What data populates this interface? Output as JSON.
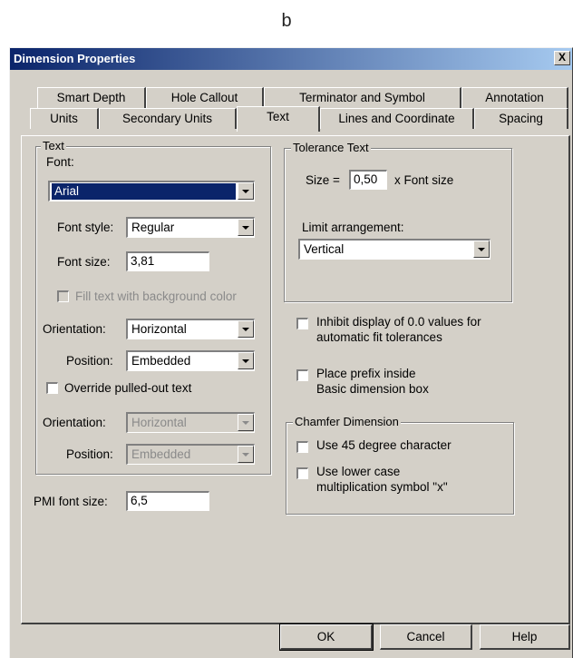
{
  "caption": "b",
  "dialog": {
    "title": "Dimension Properties",
    "close_glyph": "X"
  },
  "tabs": {
    "row1": [
      "Smart Depth",
      "Hole Callout",
      "Terminator and Symbol",
      "Annotation"
    ],
    "row2": [
      "Units",
      "Secondary Units",
      "Text",
      "Lines and Coordinate",
      "Spacing"
    ],
    "active": "Text"
  },
  "text_group": {
    "legend": "Text",
    "font_label": "Font:",
    "font_value": "Arial",
    "font_style_label": "Font style:",
    "font_style_value": "Regular",
    "font_size_label": "Font size:",
    "font_size_value": "3,81",
    "fill_background_label": "Fill text with background color",
    "orientation_label": "Orientation:",
    "orientation_value": "Horizontal",
    "position_label": "Position:",
    "position_value": "Embedded",
    "override_label": "Override pulled-out text",
    "override_orientation_label": "Orientation:",
    "override_orientation_value": "Horizontal",
    "override_position_label": "Position:",
    "override_position_value": "Embedded"
  },
  "pmi": {
    "label": "PMI font size:",
    "value": "6,5"
  },
  "tolerance_group": {
    "legend": "Tolerance Text",
    "size_label": "Size =",
    "size_value": "0,50",
    "size_suffix": "x Font size",
    "limit_label": "Limit arrangement:",
    "limit_value": "Vertical"
  },
  "options": {
    "inhibit_line1": "Inhibit display of 0.0 values for",
    "inhibit_line2": "automatic fit tolerances",
    "prefix_line1": "Place prefix inside",
    "prefix_line2": "Basic dimension box"
  },
  "chamfer_group": {
    "legend": "Chamfer Dimension",
    "use45_label": "Use 45 degree character",
    "lowercase_line1": "Use lower case",
    "lowercase_line2": "multiplication symbol \"x\""
  },
  "buttons": {
    "ok": "OK",
    "cancel": "Cancel",
    "help": "Help"
  }
}
